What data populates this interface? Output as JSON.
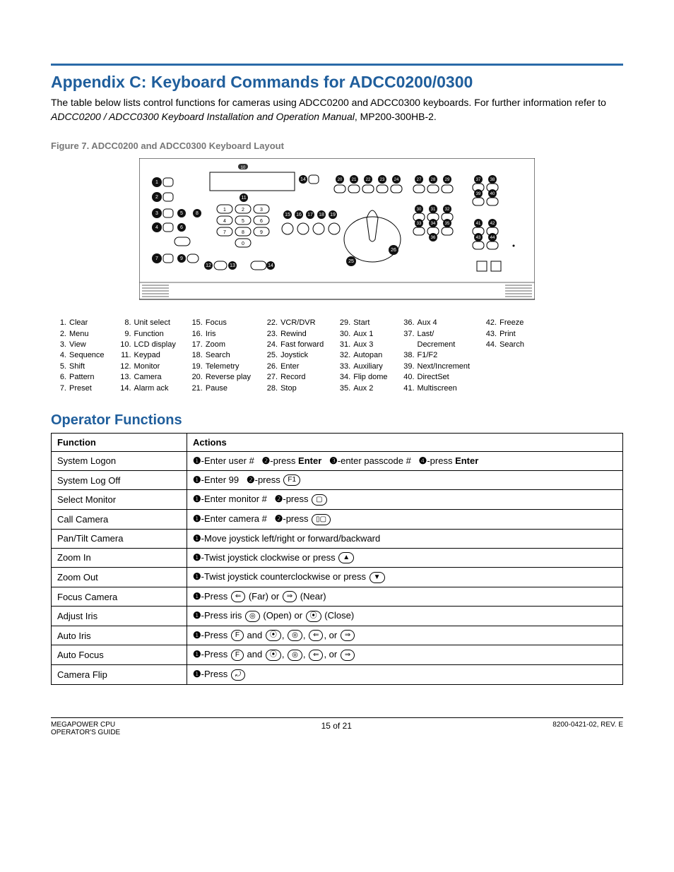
{
  "title": "Appendix C: Keyboard Commands for ADCC0200/0300",
  "intro_html": "The table below lists control functions for cameras using ADCC0200 and ADCC0300 keyboards. For further information refer to <em>ADCC0200 / ADCC0300 Keyboard Installation and Operation Manual</em>, MP200-300HB-2.",
  "figure_caption": "Figure 7. ADCC0200 and ADCC0300 Keyboard Layout",
  "legend": [
    "Clear",
    "Menu",
    "View",
    "Sequence",
    "Shift",
    "Pattern",
    "Preset",
    "Unit select",
    "Function",
    "LCD display",
    "Keypad",
    "Monitor",
    "Camera",
    "Alarm ack",
    "Focus",
    "Iris",
    "Zoom",
    "Search",
    "Telemetry",
    "Reverse play",
    "Pause",
    "VCR/DVR",
    "Rewind",
    "Fast forward",
    "Joystick",
    "Enter",
    "Record",
    "Stop",
    "Start",
    "Aux 1",
    "Aux 3",
    "Autopan",
    "Auxiliary",
    "Flip dome",
    "Aux 2",
    "Aux 4",
    "Last/ Decrement",
    "F1/F2",
    "Next/Increment",
    "DirectSet",
    "Multiscreen",
    "Freeze",
    "Print",
    "Search"
  ],
  "legend_columns": [
    [
      1,
      7
    ],
    [
      8,
      14
    ],
    [
      15,
      21
    ],
    [
      22,
      28
    ],
    [
      29,
      35
    ],
    [
      36,
      41
    ],
    [
      42,
      44
    ]
  ],
  "table": {
    "headers": [
      "Function",
      "Actions"
    ],
    "rows": [
      {
        "fn": "System Logon",
        "actions": [
          {
            "t": "step",
            "n": 1
          },
          {
            "t": "text",
            "v": "-Enter user #   "
          },
          {
            "t": "step",
            "n": 2
          },
          {
            "t": "text",
            "v": "-press "
          },
          {
            "t": "bold",
            "v": "Enter"
          },
          {
            "t": "text",
            "v": "   "
          },
          {
            "t": "step",
            "n": 3
          },
          {
            "t": "text",
            "v": "-enter passcode #   "
          },
          {
            "t": "step",
            "n": 4
          },
          {
            "t": "text",
            "v": "-press "
          },
          {
            "t": "bold",
            "v": "Enter"
          }
        ]
      },
      {
        "fn": "System Log Off",
        "actions": [
          {
            "t": "step",
            "n": 1
          },
          {
            "t": "text",
            "v": "-Enter 99   "
          },
          {
            "t": "step",
            "n": 2
          },
          {
            "t": "text",
            "v": "-press "
          },
          {
            "t": "key",
            "v": "F1"
          }
        ]
      },
      {
        "fn": "Select Monitor",
        "actions": [
          {
            "t": "step",
            "n": 1
          },
          {
            "t": "text",
            "v": "-Enter monitor #   "
          },
          {
            "t": "step",
            "n": 2
          },
          {
            "t": "text",
            "v": "-press "
          },
          {
            "t": "key",
            "v": "▢"
          }
        ]
      },
      {
        "fn": "Call Camera",
        "actions": [
          {
            "t": "step",
            "n": 1
          },
          {
            "t": "text",
            "v": "-Enter camera #   "
          },
          {
            "t": "step",
            "n": 2
          },
          {
            "t": "text",
            "v": "-press "
          },
          {
            "t": "key",
            "v": "▯▢"
          }
        ]
      },
      {
        "fn": "Pan/Tilt Camera",
        "actions": [
          {
            "t": "step",
            "n": 1
          },
          {
            "t": "text",
            "v": "-Move joystick left/right or forward/backward"
          }
        ]
      },
      {
        "fn": "Zoom In",
        "actions": [
          {
            "t": "step",
            "n": 1
          },
          {
            "t": "text",
            "v": "-Twist joystick clockwise or press "
          },
          {
            "t": "key",
            "v": "▲"
          }
        ]
      },
      {
        "fn": "Zoom Out",
        "actions": [
          {
            "t": "step",
            "n": 1
          },
          {
            "t": "text",
            "v": "-Twist joystick counterclockwise or press "
          },
          {
            "t": "key",
            "v": "▼"
          }
        ]
      },
      {
        "fn": "Focus Camera",
        "actions": [
          {
            "t": "step",
            "n": 1
          },
          {
            "t": "text",
            "v": "-Press "
          },
          {
            "t": "key",
            "v": "⇐"
          },
          {
            "t": "text",
            "v": " (Far) or "
          },
          {
            "t": "key",
            "v": "⇒"
          },
          {
            "t": "text",
            "v": " (Near)"
          }
        ]
      },
      {
        "fn": "Adjust Iris",
        "actions": [
          {
            "t": "step",
            "n": 1
          },
          {
            "t": "text",
            "v": "-Press iris "
          },
          {
            "t": "key",
            "v": "◎"
          },
          {
            "t": "text",
            "v": " (Open) or "
          },
          {
            "t": "key",
            "v": "⦿"
          },
          {
            "t": "text",
            "v": " (Close)"
          }
        ]
      },
      {
        "fn": "Auto Iris",
        "actions": [
          {
            "t": "step",
            "n": 1
          },
          {
            "t": "text",
            "v": "-Press "
          },
          {
            "t": "key",
            "v": "F"
          },
          {
            "t": "text",
            "v": " and "
          },
          {
            "t": "key",
            "v": "⦿"
          },
          {
            "t": "text",
            "v": ", "
          },
          {
            "t": "key",
            "v": "◎"
          },
          {
            "t": "text",
            "v": ", "
          },
          {
            "t": "key",
            "v": "⇐"
          },
          {
            "t": "text",
            "v": ", or "
          },
          {
            "t": "key",
            "v": "⇒"
          }
        ]
      },
      {
        "fn": "Auto Focus",
        "actions": [
          {
            "t": "step",
            "n": 1
          },
          {
            "t": "text",
            "v": "-Press "
          },
          {
            "t": "key",
            "v": "F"
          },
          {
            "t": "text",
            "v": " and "
          },
          {
            "t": "key",
            "v": "⦿"
          },
          {
            "t": "text",
            "v": ", "
          },
          {
            "t": "key",
            "v": "◎"
          },
          {
            "t": "text",
            "v": ", "
          },
          {
            "t": "key",
            "v": "⇐"
          },
          {
            "t": "text",
            "v": ", or "
          },
          {
            "t": "key",
            "v": "⇒"
          }
        ]
      },
      {
        "fn": "Camera Flip",
        "actions": [
          {
            "t": "step",
            "n": 1
          },
          {
            "t": "text",
            "v": "-Press "
          },
          {
            "t": "key",
            "v": "⤾"
          }
        ]
      }
    ]
  },
  "footer": {
    "left1": "MEGAPOWER CPU",
    "left2": "OPERATOR'S GUIDE",
    "mid": "15 of 21",
    "right": "8200-0421-02, REV. E"
  }
}
